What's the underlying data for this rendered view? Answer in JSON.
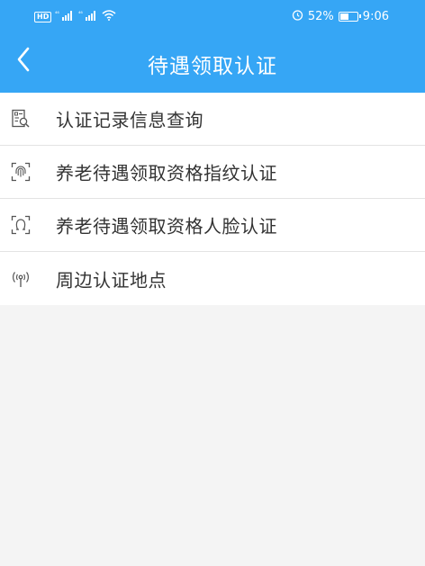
{
  "status_bar": {
    "left_badge": "HD",
    "signal_1": "⁴⁶",
    "signal_2": "⁴⁶",
    "battery_percent_text": "52%",
    "battery_level": 0.52,
    "time": "9:06"
  },
  "header": {
    "title": "待遇领取认证",
    "back_icon": "chevron-left-icon"
  },
  "menu": {
    "items": [
      {
        "label": "认证记录信息查询",
        "icon": "record-search-icon"
      },
      {
        "label": "养老待遇领取资格指纹认证",
        "icon": "fingerprint-icon"
      },
      {
        "label": "养老待遇领取资格人脸认证",
        "icon": "face-scan-icon"
      },
      {
        "label": "周边认证地点",
        "icon": "location-signal-icon"
      }
    ]
  },
  "colors": {
    "header_bg": "#36a6f5",
    "page_bg": "#f4f4f4",
    "text": "#333333",
    "divider": "#e3e3e3"
  }
}
